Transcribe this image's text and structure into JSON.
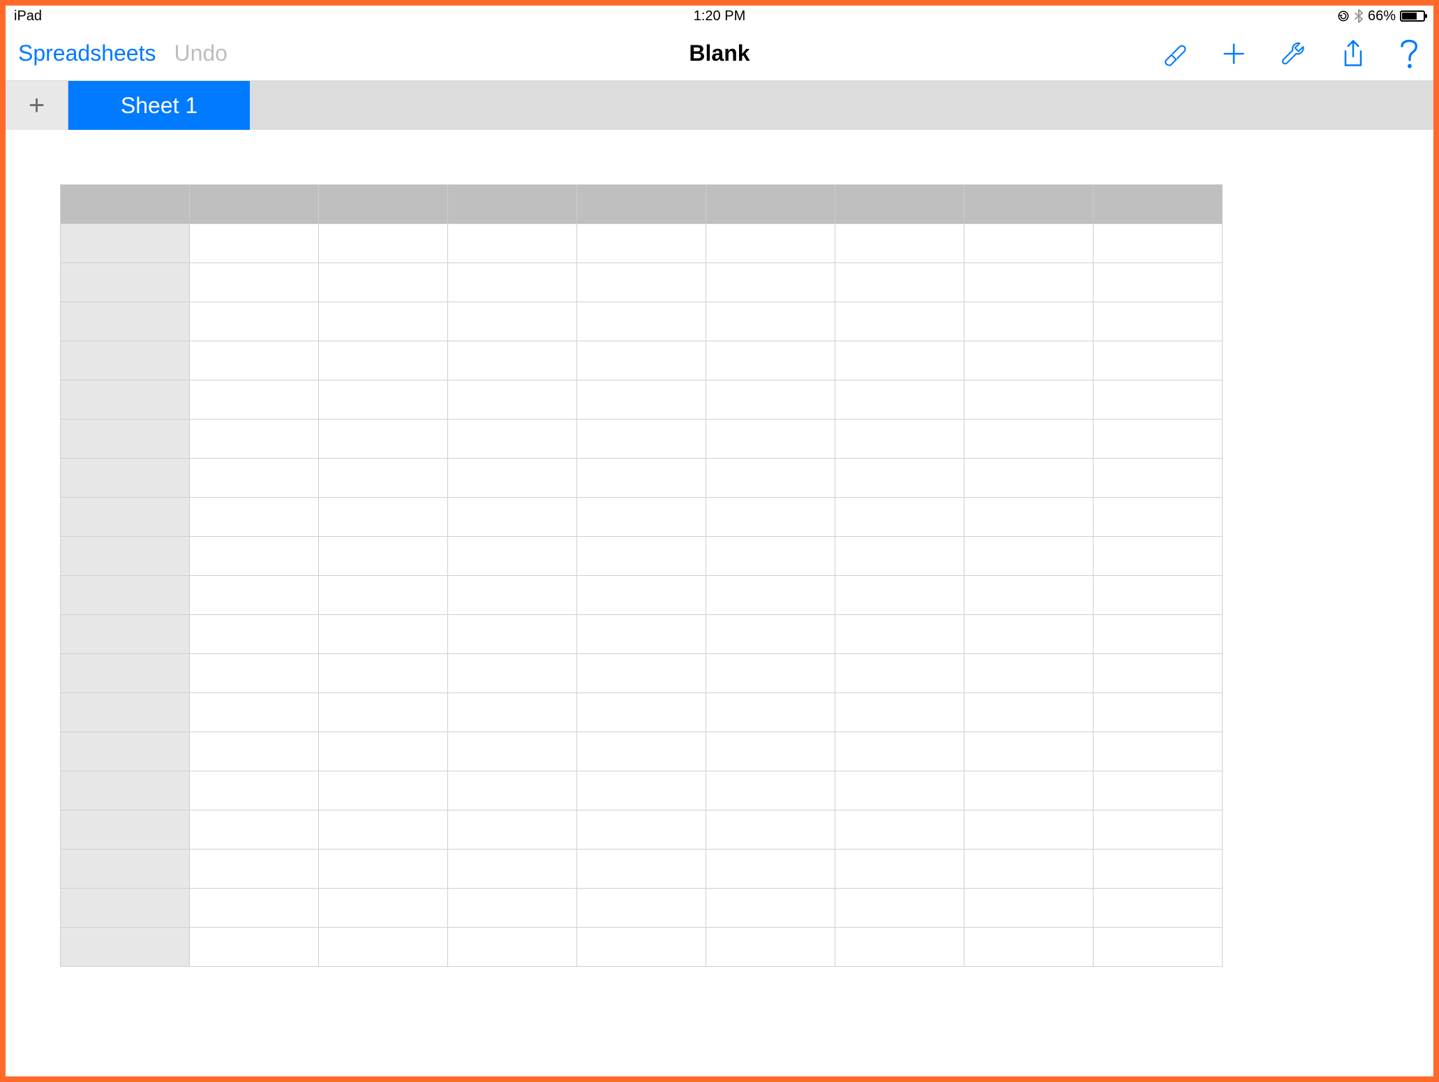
{
  "status_bar": {
    "device_label": "iPad",
    "time": "1:20 PM",
    "lock_icon": "orientation-lock-icon",
    "bluetooth_icon": "bluetooth-icon",
    "battery_percent": "66%",
    "battery_fill_percent": 66
  },
  "toolbar": {
    "back_label": "Spreadsheets",
    "undo_label": "Undo",
    "title": "Blank",
    "icons": {
      "brush": "format-brush-icon",
      "add": "plus-icon",
      "tools": "wrench-icon",
      "share": "share-icon",
      "help": "help-icon"
    }
  },
  "tabbar": {
    "add_label": "+",
    "active_tab_label": "Sheet 1"
  },
  "grid": {
    "column_count": 9,
    "row_count": 19,
    "column_headers": [
      "",
      "",
      "",
      "",
      "",
      "",
      "",
      "",
      ""
    ],
    "row_headers": [
      "",
      "",
      "",
      "",
      "",
      "",
      "",
      "",
      "",
      "",
      "",
      "",
      "",
      "",
      "",
      "",
      "",
      "",
      ""
    ],
    "cells": []
  },
  "colors": {
    "accent": "#007aff",
    "frame": "#ff6a2b",
    "tabbar_bg": "#dcdcdc",
    "col_header_bg": "#bfbfbf",
    "row_header_bg": "#e7e7e7"
  }
}
